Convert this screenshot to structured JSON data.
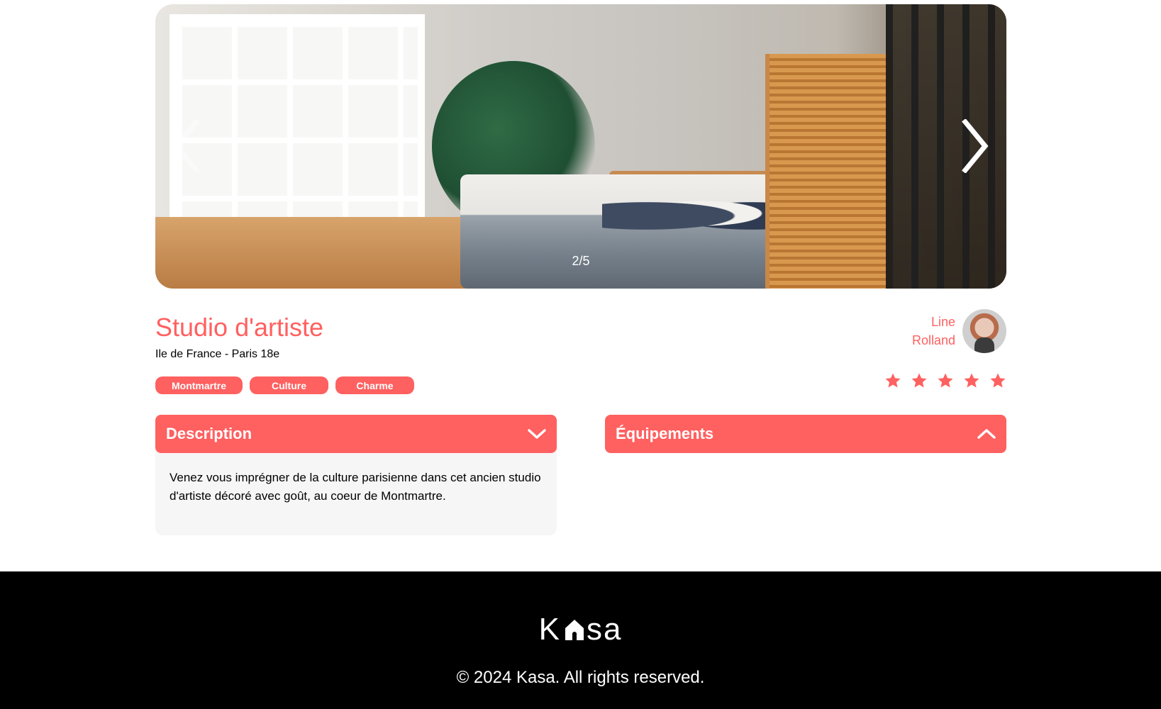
{
  "carousel": {
    "counter": "2/5",
    "prev_icon": "chevron-left-icon",
    "next_icon": "chevron-right-icon"
  },
  "listing": {
    "title": "Studio d'artiste",
    "location": "Ile de France - Paris 18e",
    "tags": [
      "Montmartre",
      "Culture",
      "Charme"
    ],
    "rating": 5,
    "rating_max": 5
  },
  "host": {
    "first_name": "Line",
    "last_name": "Rolland"
  },
  "collapses": {
    "description": {
      "title": "Description",
      "icon": "chevron-down-icon",
      "body": "Venez vous imprégner de la culture parisienne dans cet ancien studio d'artiste décoré avec goût, au coeur de Montmartre."
    },
    "equipments": {
      "title": "Équipements",
      "icon": "chevron-up-icon"
    }
  },
  "footer": {
    "logo_text_left": "K",
    "logo_text_right": "sa",
    "copyright": "© 2024 Kasa. All rights reserved."
  },
  "colors": {
    "accent": "#ff6060",
    "footer_bg": "#000000",
    "panel_bg": "#f6f6f6"
  }
}
